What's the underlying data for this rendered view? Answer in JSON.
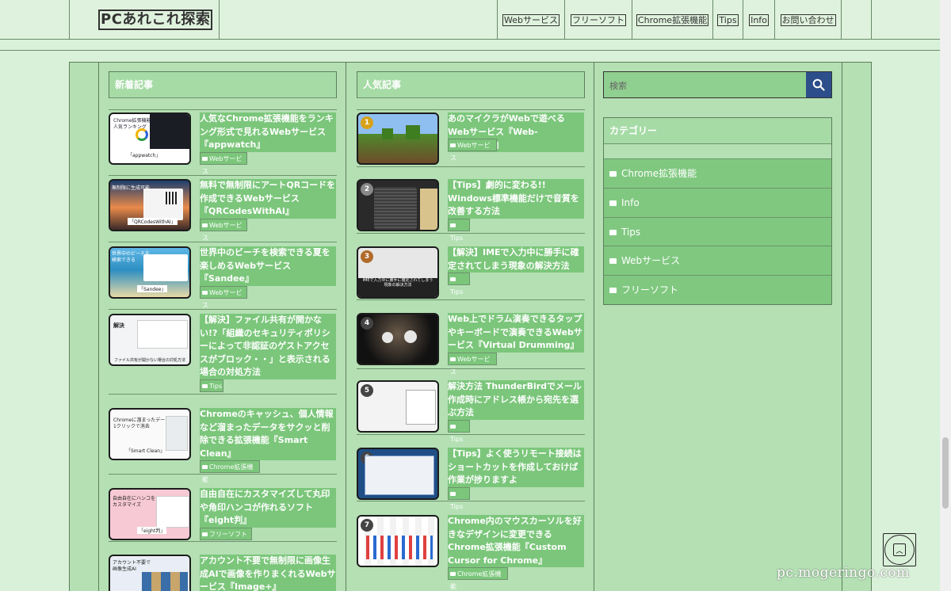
{
  "site": {
    "logo": "PCあれこれ探索"
  },
  "nav": [
    "Webサービス",
    "フリーソフト",
    "Chrome拡張機能",
    "Tips",
    "Info",
    "お問い合わせ"
  ],
  "recent": {
    "heading": "新着記事",
    "items": [
      {
        "title": "人気なChrome拡張機能をランキング形式で見れるWebサービス『appwatch』",
        "cat": "Webサービス"
      },
      {
        "title": "無料で無制限にアートQRコードを作成できるWebサービス『QRCodesWithAI』",
        "cat": "Webサービス"
      },
      {
        "title": "世界中のビーチを検索できる夏を楽しめるWebサービス『Sandee』",
        "cat": "Webサービス"
      },
      {
        "title": "【解決】ファイル共有が開かない!?「組織のセキュリティポリシーによって非認証のゲストアクセスがブロック・・」と表示される場合の対処方法",
        "cat": "Tips"
      },
      {
        "title": "Chromeのキャッシュ、個人情報など溜まったデータをサクッと削除できる拡張機能『Smart Clean』",
        "cat": "Chrome拡張機能"
      },
      {
        "title": "自由自在にカスタマイズして丸印や角印ハンコが作れるソフト『eight判』",
        "cat": "フリーソフト"
      },
      {
        "title": "アカウント不要で無制限に画像生成AIで画像を作りまくれるWebサービス『Image+』",
        "cat": ""
      }
    ]
  },
  "popular": {
    "heading": "人気記事",
    "items": [
      {
        "rank": "1",
        "title": "あのマイクラがWebで遊べるWebサービス『Web-Minecraft』",
        "cat": "Webサービス"
      },
      {
        "rank": "2",
        "title": "【Tips】劇的に変わる!! Windows標準機能だけで音質を改善する方法",
        "cat": "Tips"
      },
      {
        "rank": "3",
        "title": "【解決】IMEで入力中に勝手に確定されてしまう現象の解決方法",
        "cat": "Tips"
      },
      {
        "rank": "4",
        "title": "Web上でドラム演奏できるタップやキーボードで演奏できるWebサービス『Virtual Drumming』",
        "cat": "Webサービス"
      },
      {
        "rank": "5",
        "title": "解決方法 ThunderBirdでメール作成時にアドレス帳から宛先を選ぶ方法",
        "cat": "Tips"
      },
      {
        "rank": "6",
        "title": "【Tips】よく使うリモート接続はショートカットを作成しておけば作業が捗りますよ",
        "cat": "Tips"
      },
      {
        "rank": "7",
        "title": "Chrome内のマウスカーソルを好きなデザインに変更できるChrome拡張機能『Custom Cursor for Chrome』",
        "cat": "Chrome拡張機能"
      }
    ]
  },
  "search": {
    "placeholder": "検索"
  },
  "categories": {
    "heading": "カテゴリー",
    "items": [
      "Chrome拡張機能",
      "Info",
      "Tips",
      "Webサービス",
      "フリーソフト"
    ]
  },
  "thumb_texts": {
    "r1": "「appwatch」",
    "r1top": "Chrome拡張機能\n人気ランキング",
    "r2": "「QRCodesWithAI」",
    "r2top": "無制限に生成可能",
    "r3": "「Sandee」",
    "r3top": "世界中のビーチを\n検索できる",
    "r4": "ファイル共有が開かない場合の対処方法",
    "r4top": "解決",
    "r5": "「Smart Clean」",
    "r5top": "Chromeに溜まったデータを\n1クリックで消去",
    "r6": "「eight判」",
    "r6top": "自由自在にハンコを\nカスタマイズ",
    "r7top": "アカウント不要で\n画像生成AI",
    "p3": "IMEで入力中に勝手に確定されてしまう\n現象の解決方法"
  },
  "watermark": "pc.mogeringo.com",
  "colors": {
    "bg": "#d9f0d9",
    "panel": "#b4e0b4",
    "item": "#7bc67b",
    "searchBtn": "#2c4e8a"
  }
}
